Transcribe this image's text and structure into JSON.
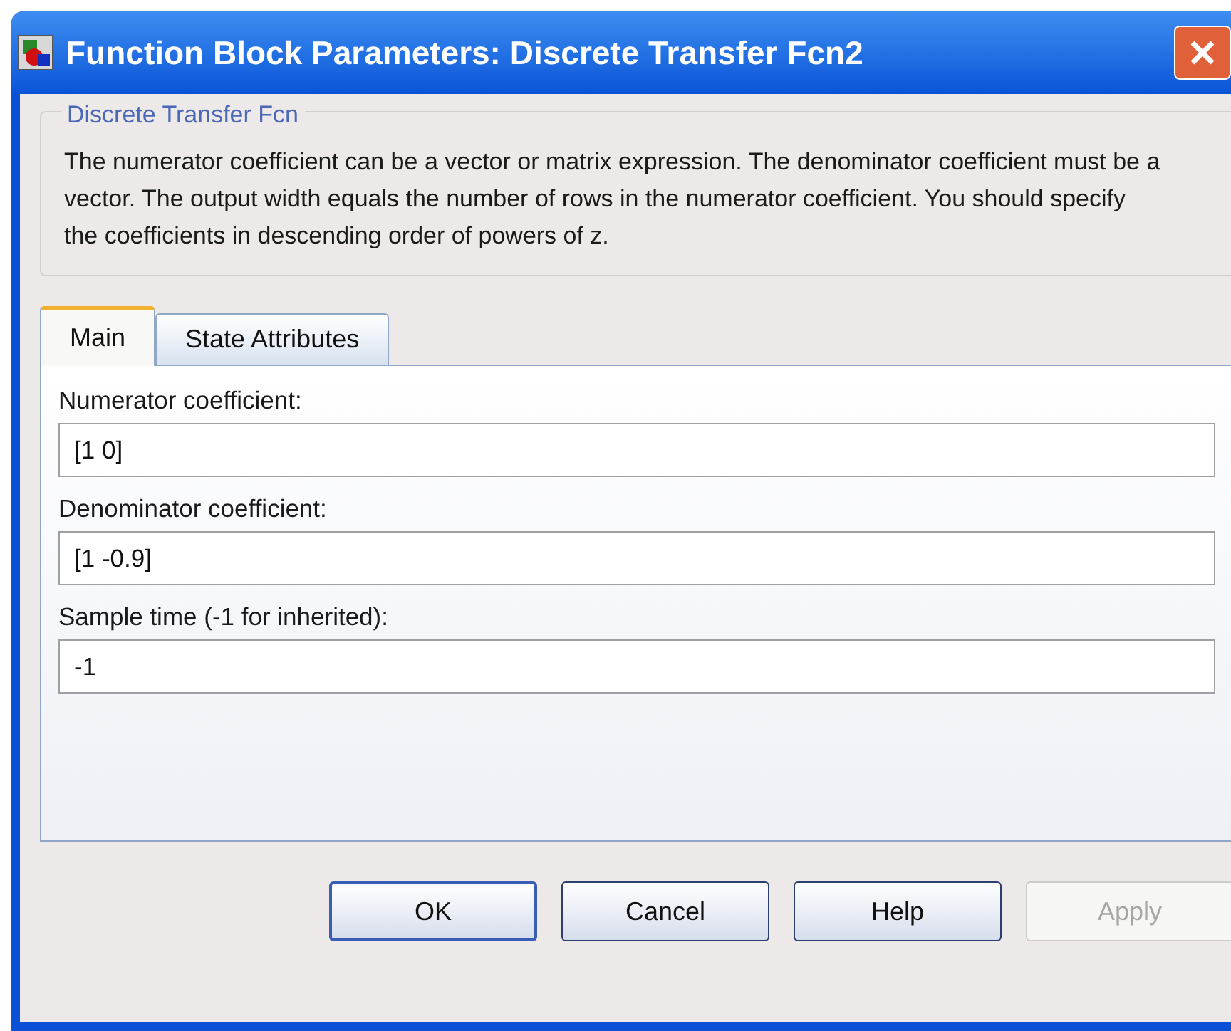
{
  "window": {
    "title": "Function Block Parameters: Discrete Transfer Fcn2"
  },
  "group": {
    "title": "Discrete Transfer Fcn",
    "description": "The numerator coefficient can be a vector or matrix expression. The denominator coefficient must be a vector. The output width equals the number of rows in the numerator coefficient. You should specify the coefficients in descending order of powers of z."
  },
  "tabs": [
    {
      "label": "Main",
      "selected": true
    },
    {
      "label": "State Attributes",
      "selected": false
    }
  ],
  "fields": [
    {
      "label": "Numerator coefficient:",
      "value": "[1 0]"
    },
    {
      "label": "Denominator coefficient:",
      "value": "[1 -0.9]"
    },
    {
      "label": "Sample time (-1 for inherited):",
      "value": "-1"
    }
  ],
  "buttons": [
    {
      "label": "OK",
      "default": true,
      "disabled": false
    },
    {
      "label": "Cancel",
      "default": false,
      "disabled": false
    },
    {
      "label": "Help",
      "default": false,
      "disabled": false
    },
    {
      "label": "Apply",
      "default": false,
      "disabled": true
    }
  ]
}
